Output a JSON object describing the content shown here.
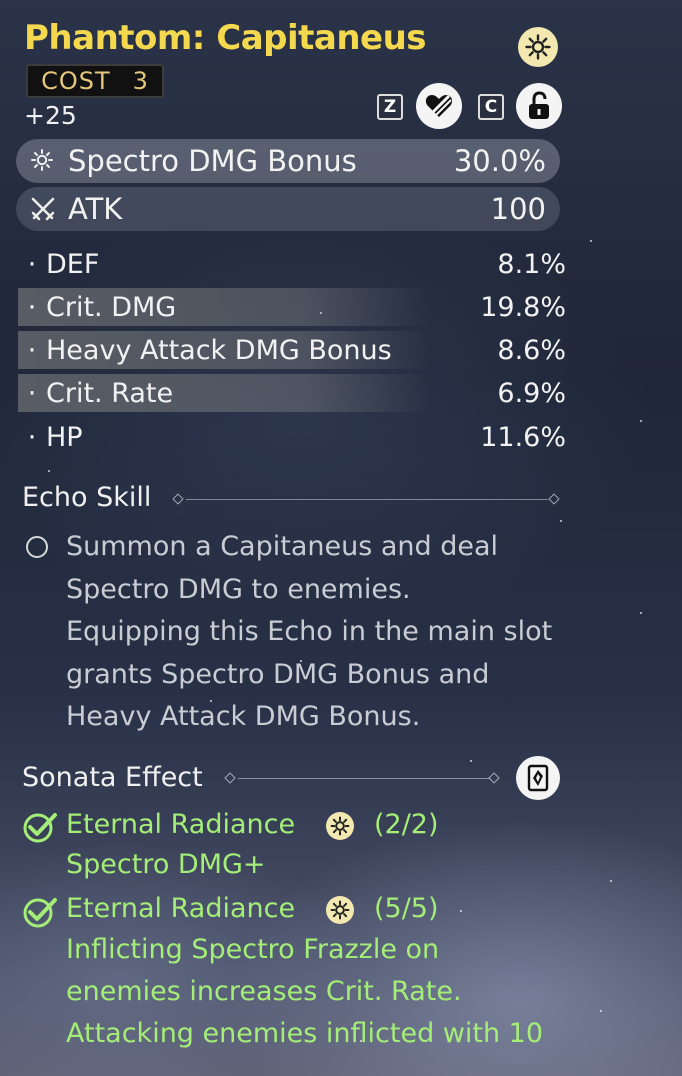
{
  "echo": {
    "name": "Phantom: Capitaneus",
    "cost_label": "COST",
    "cost_value": "3",
    "level": "+25",
    "element_icon": "spectro-element-icon",
    "lock_key": "Z",
    "discard_key": "C",
    "colors": {
      "title": "#f4d94f",
      "cost": "#e4c77a",
      "sonata_active": "#a4ee78"
    }
  },
  "main_stats": [
    {
      "icon": "spectro-icon",
      "name": "Spectro DMG Bonus",
      "value": "30.0%"
    },
    {
      "icon": "atk-swords-icon",
      "name": "ATK",
      "value": "100"
    }
  ],
  "sub_stats": [
    {
      "bullet": "·",
      "name": "DEF",
      "value": "8.1%"
    },
    {
      "bullet": "·",
      "name": "Crit. DMG",
      "value": "19.8%"
    },
    {
      "bullet": "·",
      "name": "Heavy Attack DMG Bonus",
      "value": "8.6%"
    },
    {
      "bullet": "·",
      "name": "Crit. Rate",
      "value": "6.9%"
    },
    {
      "bullet": "·",
      "name": "HP",
      "value": "11.6%"
    }
  ],
  "echo_skill": {
    "title": "Echo Skill",
    "lines": [
      "Summon a Capitaneus and deal",
      "Spectro DMG to enemies.",
      "Equipping this Echo in the main slot",
      "grants Spectro DMG Bonus and",
      "Heavy Attack DMG Bonus."
    ]
  },
  "sonata": {
    "title": "Sonata Effect",
    "sets": [
      {
        "name": "Eternal Radiance",
        "count": "(2/2)",
        "lines": [
          "Spectro DMG+"
        ]
      },
      {
        "name": "Eternal Radiance",
        "count": "(5/5)",
        "lines": [
          "Inflicting Spectro Frazzle on",
          "enemies increases Crit. Rate.",
          "Attacking enemies inflicted with 10"
        ]
      }
    ]
  }
}
